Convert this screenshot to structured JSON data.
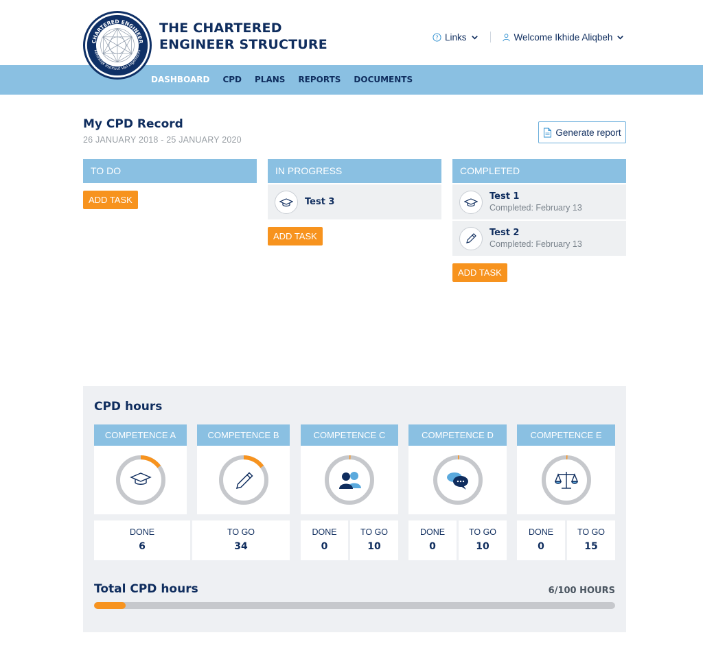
{
  "header": {
    "logo_text": "CHARTERED ENGINEER · Koninklijk Instituut Van Ingenieurs",
    "title_line1": "THE CHARTERED",
    "title_line2": "ENGINEER STRUCTURE",
    "links_label": "Links",
    "user_label": "Welcome Ikhide Aliqbeh"
  },
  "nav": {
    "items": [
      {
        "label": "DASHBOARD",
        "active": true
      },
      {
        "label": "CPD"
      },
      {
        "label": "PLANS"
      },
      {
        "label": "REPORTS"
      },
      {
        "label": "DOCUMENTS"
      }
    ]
  },
  "record": {
    "title": "My CPD Record",
    "dates": "26 JANUARY 2018 - 25 JANUARY 2020",
    "generate_label": "Generate report"
  },
  "board": {
    "add_task_label": "ADD TASK",
    "columns": [
      {
        "title": "TO DO",
        "tasks": []
      },
      {
        "title": "IN PROGRESS",
        "tasks": [
          {
            "name": "Test 3",
            "icon": "graduation-cap-icon"
          }
        ]
      },
      {
        "title": "COMPLETED",
        "tasks": [
          {
            "name": "Test 1",
            "sub": "Completed: February 13",
            "icon": "graduation-cap-icon"
          },
          {
            "name": "Test 2",
            "sub": "Completed: February 13",
            "icon": "pencil-icon"
          }
        ]
      }
    ]
  },
  "cpd": {
    "title": "CPD hours",
    "done_label": "DONE",
    "togo_label": "TO GO",
    "competences": [
      {
        "name": "COMPETENCE A",
        "done": "6",
        "to_go": "34",
        "progress": 0.15,
        "icon": "graduation-cap-icon"
      },
      {
        "name": "COMPETENCE B",
        "done": "",
        "to_go": "34",
        "progress": 0.15,
        "icon": "pencil-icon"
      },
      {
        "name": "COMPETENCE C",
        "done": "0",
        "to_go": "10",
        "progress": 0,
        "icon": "people-icon"
      },
      {
        "name": "COMPETENCE D",
        "done": "0",
        "to_go": "10",
        "progress": 0,
        "icon": "chat-icon"
      },
      {
        "name": "COMPETENCE E",
        "done": "0",
        "to_go": "15",
        "progress": 0,
        "icon": "scales-icon"
      }
    ],
    "total_title": "Total CPD hours",
    "total_value": "6/100 HOURS",
    "total_progress": 0.06
  },
  "colors": {
    "navy": "#0f2d5e",
    "light_blue": "#8ac0e2",
    "orange": "#f7931e",
    "panel_gray": "#eef0f3"
  }
}
